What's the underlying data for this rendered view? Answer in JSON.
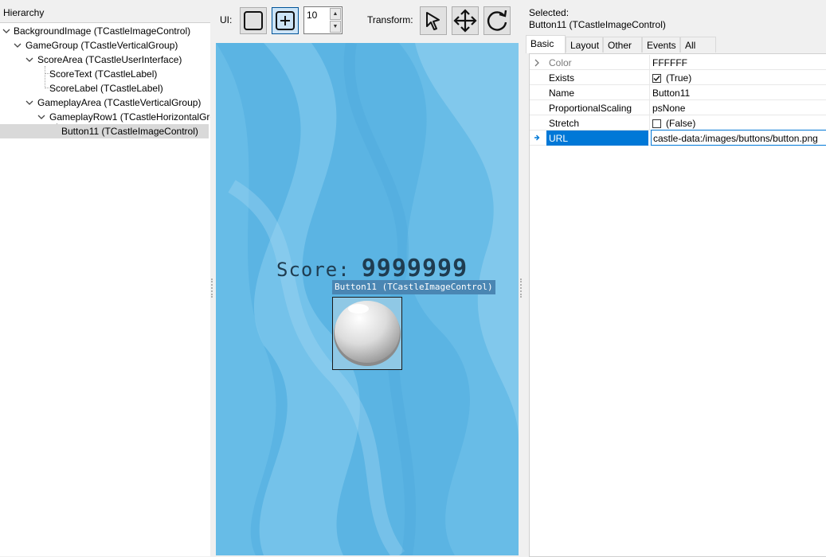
{
  "hierarchy": {
    "title": "Hierarchy",
    "nodes": [
      {
        "label": "BackgroundImage (TCastleImageControl)"
      },
      {
        "label": "GameGroup (TCastleVerticalGroup)"
      },
      {
        "label": "ScoreArea (TCastleUserInterface)"
      },
      {
        "label": "ScoreText (TCastleLabel)"
      },
      {
        "label": "ScoreLabel (TCastleLabel)"
      },
      {
        "label": "GameplayArea (TCastleVerticalGroup)"
      },
      {
        "label": "GameplayRow1 (TCastleHorizontalGro"
      },
      {
        "label": "Button11 (TCastleImageControl)"
      }
    ]
  },
  "toolbar": {
    "ui_label": "UI:",
    "spin_value": "10",
    "transform_label": "Transform:",
    "icons": [
      "rect-select-icon",
      "add-child-icon",
      "select-arrow-icon",
      "move-arrows-icon",
      "rotate-icon"
    ]
  },
  "preview": {
    "score_label": "Score:",
    "score_value": "9999999",
    "selection_tag": "Button11 (TCastleImageControl)"
  },
  "inspector": {
    "selected_label": "Selected:",
    "selected_name": "Button11 (TCastleImageControl)",
    "tabs": [
      "Basic",
      "Layout",
      "Other",
      "Events",
      "All"
    ],
    "active_tab": "Basic",
    "properties": [
      {
        "name": "Color",
        "value": "FFFFFF"
      },
      {
        "name": "Exists",
        "value": "(True)"
      },
      {
        "name": "Name",
        "value": "Button11"
      },
      {
        "name": "ProportionalScaling",
        "value": "psNone"
      },
      {
        "name": "Stretch",
        "value": "(False)"
      },
      {
        "name": "URL",
        "value": "castle-data:/images/buttons/button.png"
      }
    ]
  },
  "colors": {
    "selection_blue": "#0078d7",
    "preview_background": "#5bb4e3",
    "selection_tag": "#4a86b3"
  }
}
